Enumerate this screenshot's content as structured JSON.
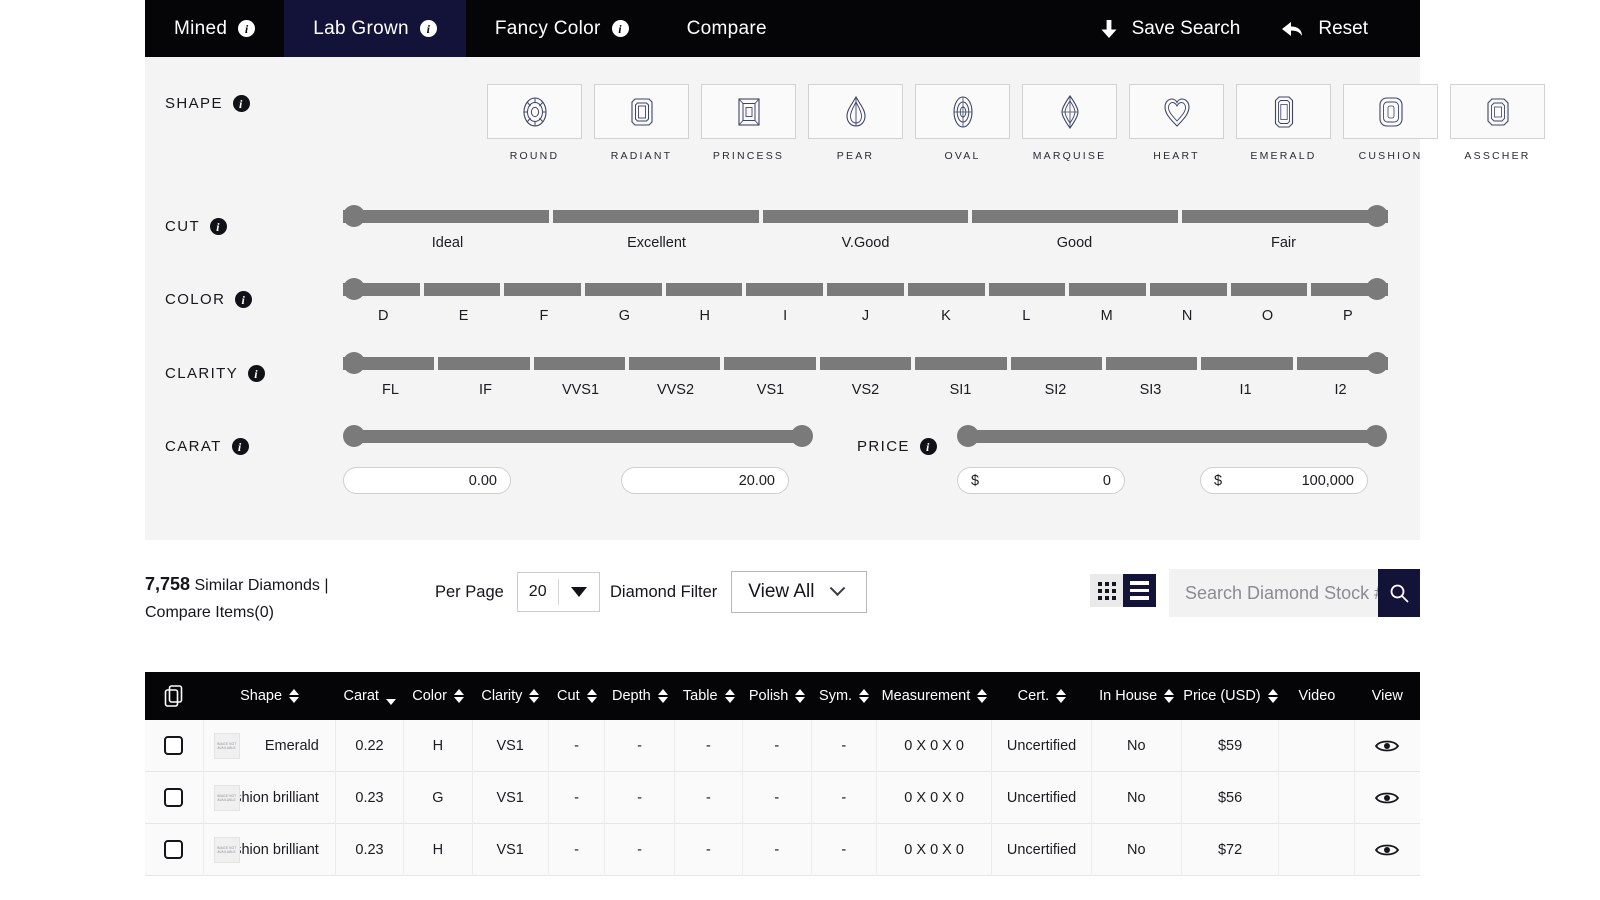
{
  "nav": {
    "tabs": [
      {
        "label": "Mined",
        "info": true,
        "active": false
      },
      {
        "label": "Lab Grown",
        "info": true,
        "active": true
      },
      {
        "label": "Fancy Color",
        "info": true,
        "active": false
      },
      {
        "label": "Compare",
        "info": false,
        "active": false
      }
    ],
    "save_search": "Save Search",
    "reset": "Reset"
  },
  "filters": {
    "shape": {
      "label": "SHAPE",
      "options": [
        "ROUND",
        "RADIANT",
        "PRINCESS",
        "PEAR",
        "OVAL",
        "MARQUISE",
        "HEART",
        "EMERALD",
        "CUSHION",
        "ASSCHER"
      ]
    },
    "cut": {
      "label": "CUT",
      "ticks": [
        "Ideal",
        "Excellent",
        "V.Good",
        "Good",
        "Fair"
      ]
    },
    "color": {
      "label": "COLOR",
      "ticks": [
        "D",
        "E",
        "F",
        "G",
        "H",
        "I",
        "J",
        "K",
        "L",
        "M",
        "N",
        "O",
        "P"
      ]
    },
    "clarity": {
      "label": "CLARITY",
      "ticks": [
        "FL",
        "IF",
        "VVS1",
        "VVS2",
        "VS1",
        "VS2",
        "SI1",
        "SI2",
        "SI3",
        "I1",
        "I2"
      ]
    },
    "carat": {
      "label": "CARAT",
      "min_value": "0.00",
      "max_value": "20.00"
    },
    "price": {
      "label": "PRICE",
      "currency": "$",
      "min_value": "0",
      "max_value": "100,000"
    }
  },
  "results": {
    "count": "7,758",
    "count_suffix": "Similar Diamonds |",
    "compare_items": "Compare Items(0)",
    "per_page_label": "Per Page",
    "per_page_value": "20",
    "diamond_filter_label": "Diamond Filter",
    "diamond_filter_value": "View All",
    "search_placeholder": "Search Diamond Stock #"
  },
  "table": {
    "columns": [
      {
        "label": "Shape",
        "sort": "both"
      },
      {
        "label": "Carat",
        "sort": "down"
      },
      {
        "label": "Color",
        "sort": "both"
      },
      {
        "label": "Clarity",
        "sort": "both"
      },
      {
        "label": "Cut",
        "sort": "both"
      },
      {
        "label": "Depth",
        "sort": "both"
      },
      {
        "label": "Table",
        "sort": "both"
      },
      {
        "label": "Polish",
        "sort": "both"
      },
      {
        "label": "Sym.",
        "sort": "both"
      },
      {
        "label": "Measurement",
        "sort": "both"
      },
      {
        "label": "Cert.",
        "sort": "both"
      },
      {
        "label": "In House",
        "sort": "both"
      },
      {
        "label": "Price (USD)",
        "sort": "both"
      },
      {
        "label": "Video",
        "sort": "none"
      },
      {
        "label": "View",
        "sort": "none"
      }
    ],
    "thumb_text": "IMAGE NOT AVAILABLE",
    "rows": [
      {
        "shape": "Emerald",
        "carat": "0.22",
        "color": "H",
        "clarity": "VS1",
        "cut": "-",
        "depth": "-",
        "table": "-",
        "polish": "-",
        "sym": "-",
        "measurement": "0 X 0 X 0",
        "cert": "Uncertified",
        "in_house": "No",
        "price": "$59"
      },
      {
        "shape": "Cushion brilliant",
        "carat": "0.23",
        "color": "G",
        "clarity": "VS1",
        "cut": "-",
        "depth": "-",
        "table": "-",
        "polish": "-",
        "sym": "-",
        "measurement": "0 X 0 X 0",
        "cert": "Uncertified",
        "in_house": "No",
        "price": "$56"
      },
      {
        "shape": "Cushion brilliant",
        "carat": "0.23",
        "color": "H",
        "clarity": "VS1",
        "cut": "-",
        "depth": "-",
        "table": "-",
        "polish": "-",
        "sym": "-",
        "measurement": "0 X 0 X 0",
        "cert": "Uncertified",
        "in_house": "No",
        "price": "$72"
      }
    ]
  },
  "colors": {
    "nav_bg": "#050508",
    "active_tab": "#13133a",
    "panel_bg": "#f4f4f4",
    "slider": "#7a7a7a",
    "gem_outline": "#3d4466"
  }
}
